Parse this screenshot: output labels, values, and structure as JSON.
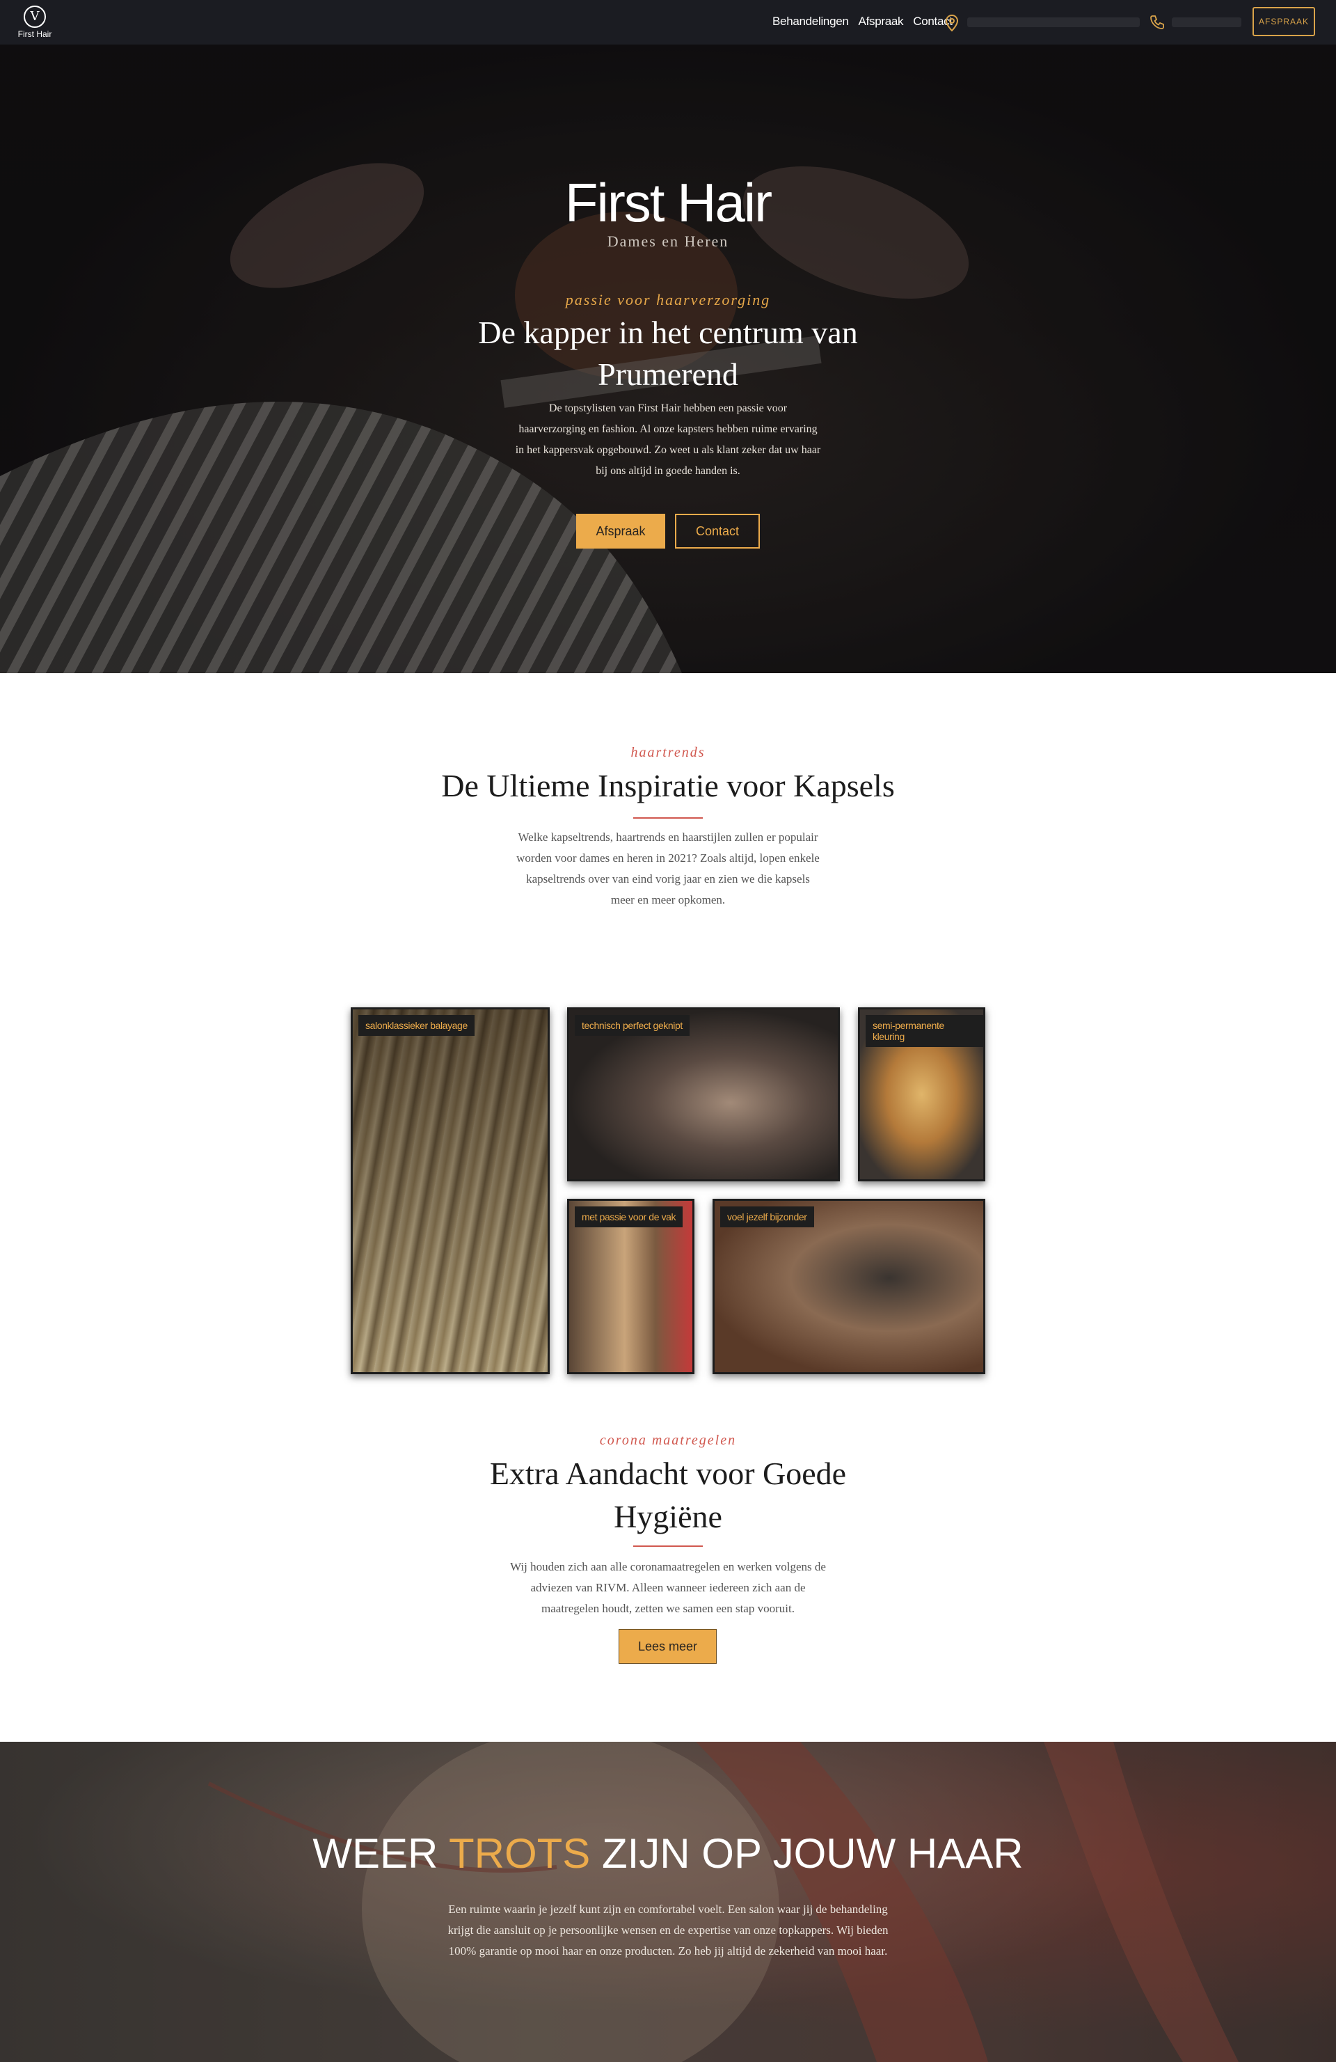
{
  "nav": {
    "logo_letter": "V",
    "logo_text": "First Hair",
    "links": [
      "Behandelingen",
      "Afspraak",
      "Contact"
    ],
    "cta": "AFSPRAAK",
    "icons": [
      "map-pin-icon",
      "phone-icon"
    ]
  },
  "hero": {
    "title": "First Hair",
    "subtitle": "Dames en Heren",
    "tag": "passie voor haarverzorging",
    "heading": "De kapper in het centrum van Prumerend",
    "text": "De topstylisten van First Hair hebben een passie voor haarverzorging en fashion. Al onze kapsters hebben ruime ervaring in het kappersvak opgebouwd. Zo weet u als klant zeker dat uw haar bij ons altijd in goede handen is.",
    "btn_primary": "Afspraak",
    "btn_secondary": "Contact"
  },
  "trends": {
    "kicker": "haartrends",
    "heading": "De Ultieme Inspiratie voor Kapsels",
    "text": "Welke kapseltrends, haartrends en haarstijlen zullen er populair worden voor dames en heren in 2021? Zoals altijd, lopen enkele kapseltrends over van eind vorig jaar en zien we die kapsels meer en meer opkomen."
  },
  "gallery": {
    "labels": [
      "salonklassieker balayage",
      "technisch perfect geknipt",
      "semi-permanente kleuring",
      "met passie voor de vak",
      "voel jezelf bijzonder"
    ]
  },
  "hygiene": {
    "kicker": "corona maatregelen",
    "heading": "Extra Aandacht voor Goede Hygiëne",
    "text": "Wij houden zich aan alle coronamaatregelen en werken volgens de adviezen van RIVM. Alleen wanneer iedereen zich aan de maatregelen houdt, zetten we samen een stap vooruit.",
    "button": "Lees meer"
  },
  "banner": {
    "title_before": "WEER",
    "title_accent": "TROTS",
    "title_after": "ZIJN OP JOUW HAAR",
    "text": "Een ruimte waarin je jezelf kunt zijn en comfortabel voelt. Een salon waar jij de behandeling krijgt die aansluit op je persoonlijke wensen en de expertise van onze topkappers. Wij bieden 100% garantie op mooi haar en onze producten. Zo heb jij altijd de zekerheid van mooi haar."
  },
  "colors": {
    "accent": "#ecab4b",
    "kicker": "#d1584f",
    "nav_bg": "#1b1c22"
  }
}
